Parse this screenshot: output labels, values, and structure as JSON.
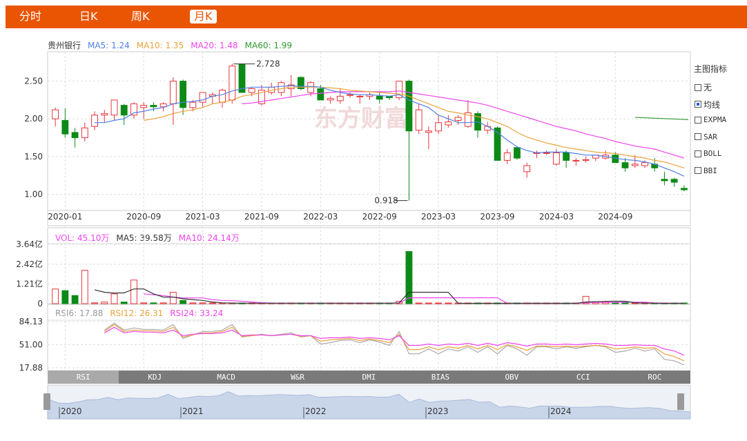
{
  "tabs": [
    {
      "label": "分时",
      "active": false
    },
    {
      "label": "日K",
      "active": false
    },
    {
      "label": "周K",
      "active": false
    },
    {
      "label": "月K",
      "active": true
    }
  ],
  "stock_name": "贵州银行",
  "ma_legend": [
    {
      "label": "MA5: 1.24",
      "color": "#4f7fe6"
    },
    {
      "label": "MA10: 1.35",
      "color": "#e9a23b"
    },
    {
      "label": "MA20: 1.48",
      "color": "#ee44ee"
    },
    {
      "label": "MA60: 1.99",
      "color": "#2e9a2e"
    }
  ],
  "vol_legend": [
    {
      "label": "VOL: 45.10万",
      "color": "#ee44ee"
    },
    {
      "label": "MA5: 39.58万",
      "color": "#333333"
    },
    {
      "label": "MA10: 24.14万",
      "color": "#ee44ee"
    }
  ],
  "rsi_legend": [
    {
      "label": "RSI6: 17.88",
      "color": "#999999"
    },
    {
      "label": "RSI12: 26.31",
      "color": "#e9a23b"
    },
    {
      "label": "RSI24: 33.24",
      "color": "#ee44ee"
    }
  ],
  "side_panel": {
    "title": "主图指标",
    "items": [
      {
        "label": "无",
        "checked": false,
        "mono": false
      },
      {
        "label": "均线",
        "checked": true,
        "mono": false
      },
      {
        "label": "EXPMA",
        "checked": false,
        "mono": true
      },
      {
        "label": "SAR",
        "checked": false,
        "mono": true
      },
      {
        "label": "BOLL",
        "checked": false,
        "mono": true
      },
      {
        "label": "BBI",
        "checked": false,
        "mono": true
      }
    ]
  },
  "indicator_tabs": [
    {
      "label": "RSI",
      "active": true
    },
    {
      "label": "KDJ",
      "active": false
    },
    {
      "label": "MACD",
      "active": false
    },
    {
      "label": "W&R",
      "active": false
    },
    {
      "label": "DMI",
      "active": false
    },
    {
      "label": "BIAS",
      "active": false
    },
    {
      "label": "OBV",
      "active": false
    },
    {
      "label": "CCI",
      "active": false
    },
    {
      "label": "ROC",
      "active": false
    }
  ],
  "navigator_years": [
    "2020",
    "2021",
    "2022",
    "2023",
    "2024"
  ],
  "watermark": "东方财富",
  "colors": {
    "up": "#e8343a",
    "down": "#0c8a17",
    "accent": "#e95503"
  },
  "chart_data": [
    {
      "type": "candlestick",
      "title": "",
      "ylim": [
        0.85,
        2.88
      ],
      "yticks": [
        "2.50",
        "2.00",
        "1.50",
        "1.00"
      ],
      "ytick_values": [
        2.5,
        2.0,
        1.5,
        1.0
      ],
      "xtick_labels": [
        "2020-01",
        "2020-09",
        "2021-03",
        "2021-09",
        "2022-03",
        "2022-09",
        "2023-03",
        "2023-09",
        "2024-03",
        "2024-09"
      ],
      "xtick_index": [
        1,
        9,
        15,
        21,
        27,
        33,
        39,
        45,
        51,
        57
      ],
      "annotations": [
        {
          "label": "2.728",
          "index": 18,
          "value": 2.728
        },
        {
          "label": "0.918",
          "index": 36,
          "value": 0.918
        }
      ],
      "ohlc": [
        [
          2.0,
          2.15,
          1.9,
          2.12
        ],
        [
          1.98,
          2.14,
          1.75,
          1.8
        ],
        [
          1.82,
          1.88,
          1.62,
          1.75
        ],
        [
          1.75,
          1.95,
          1.7,
          1.88
        ],
        [
          1.9,
          2.1,
          1.85,
          2.05
        ],
        [
          2.05,
          2.12,
          1.95,
          2.07
        ],
        [
          2.05,
          2.25,
          1.98,
          2.25
        ],
        [
          2.18,
          2.2,
          1.92,
          2.05
        ],
        [
          2.05,
          2.22,
          2.0,
          2.2
        ],
        [
          2.15,
          2.22,
          2.0,
          2.18
        ],
        [
          2.18,
          2.22,
          2.1,
          2.16
        ],
        [
          2.16,
          2.22,
          2.1,
          2.2
        ],
        [
          2.2,
          2.55,
          1.92,
          2.5
        ],
        [
          2.5,
          2.52,
          2.05,
          2.15
        ],
        [
          2.15,
          2.25,
          2.1,
          2.22
        ],
        [
          2.22,
          2.35,
          2.15,
          2.35
        ],
        [
          2.3,
          2.35,
          2.2,
          2.32
        ],
        [
          2.22,
          2.4,
          2.15,
          2.38
        ],
        [
          2.25,
          2.73,
          2.2,
          2.7
        ],
        [
          2.72,
          2.73,
          2.35,
          2.35
        ],
        [
          2.35,
          2.42,
          2.3,
          2.4
        ],
        [
          2.2,
          2.45,
          2.18,
          2.38
        ],
        [
          2.35,
          2.48,
          2.32,
          2.42
        ],
        [
          2.35,
          2.5,
          2.3,
          2.48
        ],
        [
          2.4,
          2.58,
          2.3,
          2.45
        ],
        [
          2.55,
          2.56,
          2.38,
          2.4
        ],
        [
          2.35,
          2.5,
          2.3,
          2.48
        ],
        [
          2.4,
          2.45,
          2.25,
          2.25
        ],
        [
          2.25,
          2.3,
          2.2,
          2.27
        ],
        [
          2.24,
          2.4,
          2.2,
          2.3
        ],
        [
          2.32,
          2.35,
          2.28,
          2.32
        ],
        [
          2.3,
          2.32,
          2.2,
          2.3
        ],
        [
          2.3,
          2.35,
          2.25,
          2.32
        ],
        [
          2.3,
          2.35,
          2.2,
          2.26
        ],
        [
          2.3,
          2.3,
          2.25,
          2.28
        ],
        [
          2.28,
          2.5,
          2.25,
          2.5
        ],
        [
          2.5,
          2.52,
          0.918,
          1.84
        ],
        [
          1.85,
          2.2,
          1.8,
          2.12
        ],
        [
          1.82,
          1.9,
          1.6,
          1.84
        ],
        [
          1.84,
          2.05,
          1.8,
          1.95
        ],
        [
          1.92,
          2.05,
          1.88,
          1.96
        ],
        [
          1.98,
          2.05,
          1.92,
          2.02
        ],
        [
          1.9,
          2.25,
          1.88,
          2.08
        ],
        [
          2.07,
          2.1,
          1.75,
          1.85
        ],
        [
          1.85,
          1.96,
          1.8,
          1.9
        ],
        [
          1.88,
          1.9,
          1.45,
          1.45
        ],
        [
          1.45,
          1.6,
          1.4,
          1.55
        ],
        [
          1.62,
          1.62,
          1.46,
          1.48
        ],
        [
          1.3,
          1.42,
          1.22,
          1.38
        ],
        [
          1.55,
          1.58,
          1.48,
          1.55
        ],
        [
          1.55,
          1.58,
          1.52,
          1.55
        ],
        [
          1.4,
          1.6,
          1.38,
          1.55
        ],
        [
          1.55,
          1.58,
          1.35,
          1.45
        ],
        [
          1.45,
          1.48,
          1.38,
          1.45
        ],
        [
          1.45,
          1.5,
          1.42,
          1.46
        ],
        [
          1.48,
          1.52,
          1.44,
          1.52
        ],
        [
          1.48,
          1.58,
          1.46,
          1.52
        ],
        [
          1.52,
          1.56,
          1.42,
          1.42
        ],
        [
          1.42,
          1.48,
          1.3,
          1.35
        ],
        [
          1.38,
          1.52,
          1.35,
          1.4
        ],
        [
          1.38,
          1.45,
          1.35,
          1.42
        ],
        [
          1.4,
          1.48,
          1.3,
          1.35
        ],
        [
          1.2,
          1.3,
          1.12,
          1.18
        ],
        [
          1.2,
          1.22,
          1.1,
          1.16
        ],
        [
          1.08,
          1.12,
          1.04,
          1.06
        ]
      ],
      "ma5": [
        null,
        null,
        null,
        null,
        1.95,
        1.95,
        1.98,
        2.0,
        2.08,
        2.1,
        2.13,
        2.15,
        2.2,
        2.22,
        2.23,
        2.25,
        2.3,
        2.32,
        2.37,
        2.4,
        2.42,
        2.42,
        2.42,
        2.43,
        2.44,
        2.43,
        2.43,
        2.42,
        2.38,
        2.35,
        2.33,
        2.32,
        2.32,
        2.31,
        2.3,
        2.32,
        2.25,
        2.2,
        2.15,
        2.05,
        2.0,
        1.95,
        1.95,
        1.96,
        1.9,
        1.82,
        1.72,
        1.63,
        1.58,
        1.55,
        1.56,
        1.56,
        1.56,
        1.54,
        1.52,
        1.52,
        1.5,
        1.48,
        1.46,
        1.45,
        1.43,
        1.4,
        1.35,
        1.3,
        1.24
      ],
      "ma10": [
        null,
        null,
        null,
        null,
        null,
        null,
        null,
        null,
        null,
        1.98,
        2.0,
        2.03,
        2.07,
        2.1,
        2.12,
        2.15,
        2.2,
        2.22,
        2.25,
        2.3,
        2.32,
        2.35,
        2.38,
        2.4,
        2.42,
        2.42,
        2.42,
        2.42,
        2.41,
        2.4,
        2.38,
        2.37,
        2.36,
        2.35,
        2.34,
        2.33,
        2.3,
        2.25,
        2.2,
        2.15,
        2.1,
        2.08,
        2.05,
        2.03,
        2.0,
        1.95,
        1.9,
        1.82,
        1.76,
        1.72,
        1.68,
        1.65,
        1.62,
        1.6,
        1.58,
        1.56,
        1.55,
        1.54,
        1.52,
        1.5,
        1.48,
        1.45,
        1.43,
        1.39,
        1.35
      ],
      "ma20": [
        null,
        null,
        null,
        null,
        null,
        null,
        null,
        null,
        null,
        null,
        null,
        null,
        null,
        null,
        null,
        null,
        null,
        null,
        null,
        2.2,
        2.21,
        2.23,
        2.25,
        2.27,
        2.29,
        2.31,
        2.33,
        2.34,
        2.35,
        2.36,
        2.36,
        2.36,
        2.36,
        2.36,
        2.36,
        2.37,
        2.35,
        2.33,
        2.31,
        2.29,
        2.27,
        2.25,
        2.23,
        2.21,
        2.18,
        2.14,
        2.1,
        2.06,
        2.02,
        1.98,
        1.94,
        1.9,
        1.87,
        1.84,
        1.8,
        1.77,
        1.74,
        1.7,
        1.67,
        1.64,
        1.62,
        1.6,
        1.56,
        1.52,
        1.48
      ],
      "ma60_segment": {
        "from_index": 59,
        "to_index": 64,
        "values": [
          2.02,
          1.99
        ]
      },
      "volume": [
        0.9,
        0.8,
        0.5,
        2.05,
        0.05,
        0.1,
        0.6,
        0.1,
        1.45,
        0.05,
        0.05,
        0.05,
        0.7,
        0.2,
        0.05,
        0.05,
        0.03,
        0.03,
        0.03,
        0.03,
        0.03,
        0.03,
        0.03,
        0.03,
        0.03,
        0.03,
        0.03,
        0.03,
        0.03,
        0.03,
        0.03,
        0.03,
        0.03,
        0.03,
        0.03,
        0.15,
        3.2,
        0.02,
        0.02,
        0.02,
        0.02,
        0.02,
        0.02,
        0.02,
        0.02,
        0.02,
        0.02,
        0.02,
        0.02,
        0.02,
        0.02,
        0.02,
        0.02,
        0.02,
        0.45,
        0.12,
        0.1,
        0.05,
        0.03,
        0.02,
        0.02,
        0.02,
        0.02,
        0.02,
        0.02
      ],
      "vol_yticks": [
        "3.64亿",
        "2.42亿",
        "1.21亿",
        "0"
      ],
      "vol_ylim": [
        0,
        3.64
      ],
      "vol_ma5": [
        null,
        null,
        null,
        null,
        0.85,
        0.7,
        0.65,
        0.66,
        0.9,
        0.9,
        0.6,
        0.4,
        0.4,
        0.3,
        0.25,
        0.2,
        0.1,
        0.05,
        0.04,
        0.03,
        0.03,
        0.03,
        0.03,
        0.03,
        0.03,
        0.03,
        0.03,
        0.03,
        0.03,
        0.03,
        0.03,
        0.03,
        0.03,
        0.03,
        0.03,
        0.05,
        0.7,
        0.7,
        0.7,
        0.7,
        0.7,
        0.02,
        0.02,
        0.02,
        0.02,
        0.02,
        0.02,
        0.02,
        0.02,
        0.02,
        0.02,
        0.02,
        0.02,
        0.02,
        0.1,
        0.12,
        0.14,
        0.15,
        0.15,
        0.06,
        0.04,
        0.03,
        0.02,
        0.02,
        0.02
      ],
      "vol_ma10": [
        null,
        null,
        null,
        null,
        null,
        null,
        null,
        null,
        null,
        0.6,
        0.55,
        0.5,
        0.4,
        0.35,
        0.35,
        0.35,
        0.25,
        0.2,
        0.18,
        0.15,
        0.1,
        0.06,
        0.04,
        0.03,
        0.03,
        0.03,
        0.03,
        0.03,
        0.03,
        0.03,
        0.03,
        0.03,
        0.03,
        0.03,
        0.03,
        0.04,
        0.36,
        0.36,
        0.36,
        0.36,
        0.36,
        0.36,
        0.36,
        0.36,
        0.36,
        0.36,
        0.02,
        0.02,
        0.02,
        0.02,
        0.02,
        0.02,
        0.02,
        0.02,
        0.06,
        0.07,
        0.08,
        0.08,
        0.09,
        0.09,
        0.09,
        0.05,
        0.04,
        0.03,
        0.03
      ],
      "rsi_yticks": [
        "84.13",
        "51.00",
        "17.88"
      ],
      "rsi_ylim": [
        17.88,
        84.13
      ],
      "rsi6": [
        null,
        null,
        null,
        null,
        null,
        72,
        82,
        72,
        75,
        73,
        73,
        72,
        80,
        60,
        65,
        70,
        70,
        72,
        80,
        62,
        64,
        66,
        64,
        66,
        68,
        62,
        64,
        52,
        54,
        57,
        58,
        54,
        58,
        55,
        50,
        70,
        38,
        38,
        45,
        38,
        45,
        42,
        48,
        40,
        48,
        38,
        50,
        45,
        36,
        48,
        48,
        45,
        48,
        46,
        48,
        50,
        48,
        40,
        42,
        46,
        42,
        45,
        30,
        28,
        22
      ],
      "rsi12": [
        null,
        null,
        null,
        null,
        null,
        70,
        80,
        70,
        72,
        71,
        71,
        70,
        76,
        62,
        65,
        68,
        68,
        70,
        76,
        63,
        64,
        65,
        64,
        65,
        66,
        63,
        64,
        56,
        58,
        59,
        60,
        57,
        59,
        57,
        54,
        66,
        44,
        44,
        48,
        44,
        48,
        46,
        50,
        45,
        50,
        44,
        51,
        48,
        43,
        49,
        49,
        48,
        49,
        48,
        49,
        50,
        49,
        45,
        46,
        48,
        46,
        47,
        38,
        34,
        28
      ],
      "rsi24": [
        null,
        null,
        null,
        null,
        null,
        68,
        76,
        68,
        70,
        69,
        69,
        68,
        72,
        64,
        66,
        67,
        67,
        68,
        72,
        64,
        65,
        65,
        64,
        65,
        66,
        64,
        64,
        60,
        61,
        61,
        62,
        60,
        61,
        60,
        58,
        64,
        50,
        50,
        52,
        50,
        52,
        51,
        53,
        50,
        53,
        50,
        54,
        52,
        49,
        52,
        52,
        51,
        52,
        51,
        52,
        53,
        52,
        50,
        50,
        51,
        50,
        50,
        45,
        42,
        36
      ]
    }
  ]
}
